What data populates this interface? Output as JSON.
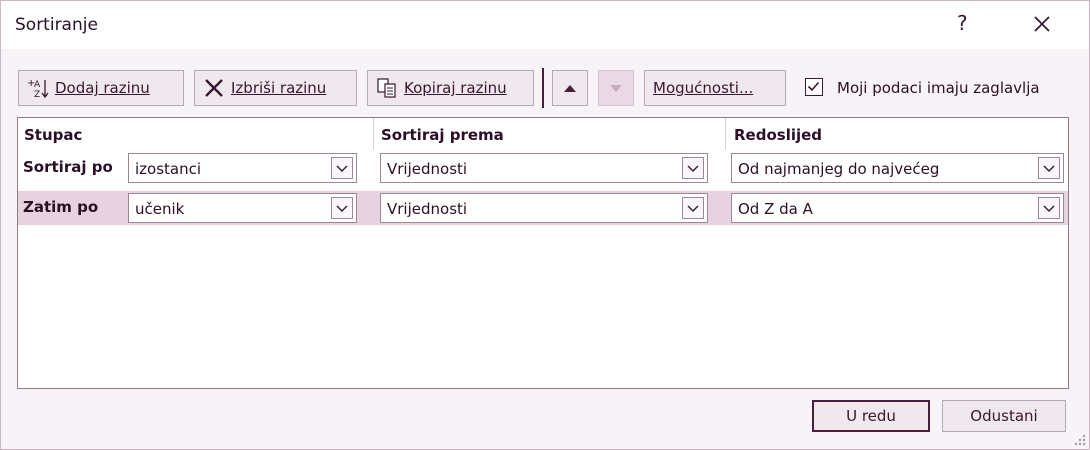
{
  "window": {
    "title": "Sortiranje",
    "help_label": "?"
  },
  "toolbar": {
    "add_level": "Dodaj razinu",
    "delete_level": "Izbriši razinu",
    "copy_level": "Kopiraj razinu",
    "options": "Mogućnosti...",
    "move_up_icon": "triangle-up-icon",
    "move_down_icon": "triangle-down-icon",
    "move_down_enabled": false,
    "headers_checkbox_label": "Moji podaci imaju zaglavlja",
    "headers_checked": true
  },
  "grid": {
    "headers": {
      "column": "Stupac",
      "sort_on": "Sortiraj prema",
      "order": "Redoslijed"
    },
    "rows": [
      {
        "label": "Sortiraj po",
        "column": "izostanci",
        "sort_on": "Vrijednosti",
        "order": "Od najmanjeg do najvećeg",
        "selected": false
      },
      {
        "label": "Zatim po",
        "column": "učenik",
        "sort_on": "Vrijednosti",
        "order": "Od Z da A",
        "selected": true
      }
    ]
  },
  "buttons": {
    "ok": "U redu",
    "cancel": "Odustani"
  },
  "colors": {
    "accent": "#4a1d3d",
    "selected_row": "#e6d3df",
    "dialog_bg": "#f7f3f6"
  }
}
